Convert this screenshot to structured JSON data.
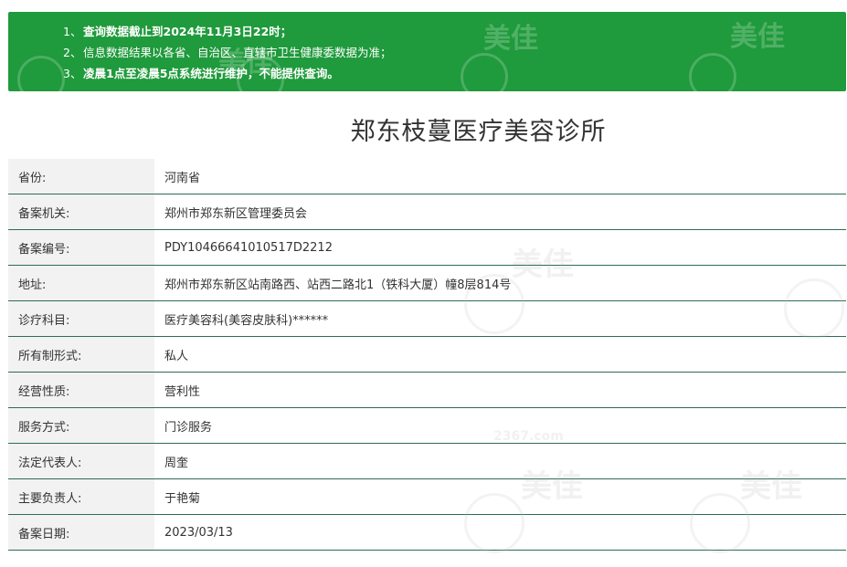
{
  "notice": {
    "lines": [
      {
        "num": "1、",
        "text": "查询数据截止到2024年11月3日22时；"
      },
      {
        "num": "2、",
        "text": "信息数据结果以各省、自治区、直辖市卫生健康委数据为准；"
      },
      {
        "num": "3、",
        "text": "凌晨1点至凌晨5点系统进行维护，不能提供查询。"
      }
    ],
    "color": "#1f9a3c"
  },
  "title": "郑东枝蔓医疗美容诊所",
  "rows": [
    {
      "label": "省份:",
      "value": "河南省"
    },
    {
      "label": "备案机关:",
      "value": "郑州市郑东新区管理委员会"
    },
    {
      "label": "备案编号:",
      "value": "PDY10466641010517D2212"
    },
    {
      "label": "地址:",
      "value": "郑州市郑东新区站南路西、站西二路北1（铁科大厦）幢8层814号"
    },
    {
      "label": "诊疗科目:",
      "value": "医疗美容科(美容皮肤科)******"
    },
    {
      "label": "所有制形式:",
      "value": "私人"
    },
    {
      "label": "经营性质:",
      "value": "营利性"
    },
    {
      "label": "服务方式:",
      "value": "门诊服务"
    },
    {
      "label": "法定代表人:",
      "value": "周奎"
    },
    {
      "label": "主要负责人:",
      "value": "于艳菊"
    },
    {
      "label": "备案日期:",
      "value": "2023/03/13"
    }
  ],
  "watermark": {
    "brand": "美佳",
    "site": "2367.com"
  },
  "colors": {
    "row_border": "#2e6b5b",
    "label_bg": "#f2f2f2"
  }
}
